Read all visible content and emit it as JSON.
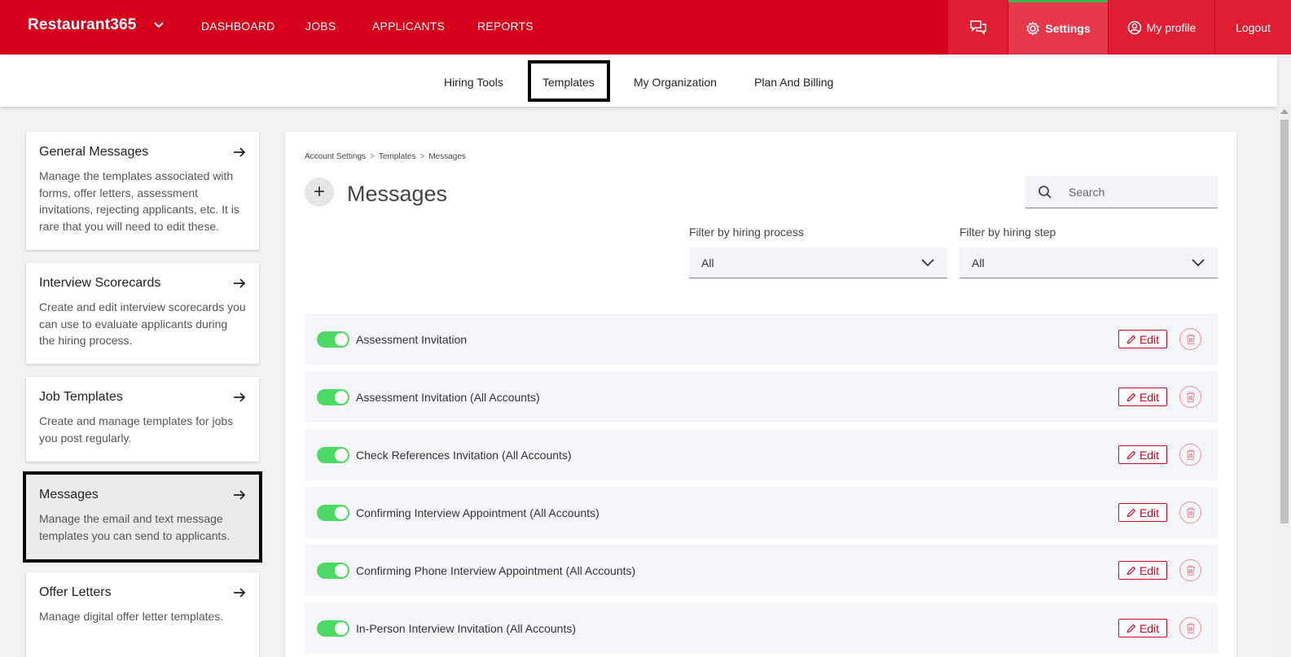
{
  "topbar": {
    "brand": "Restaurant365",
    "nav": [
      "DASHBOARD",
      "JOBS",
      "APPLICANTS",
      "REPORTS"
    ],
    "settings_label": "Settings",
    "profile_label": "My profile",
    "logout_label": "Logout"
  },
  "subnav": {
    "items": [
      "Hiring Tools",
      "Templates",
      "My Organization",
      "Plan And Billing"
    ]
  },
  "sidebar": {
    "cards": [
      {
        "title": "General Messages",
        "desc": "Manage the templates associated with forms, offer letters, assessment invitations, rejecting applicants, etc. It is rare that you will need to edit these."
      },
      {
        "title": "Interview Scorecards",
        "desc": "Create and edit interview scorecards you can use to evaluate applicants during the hiring process."
      },
      {
        "title": "Job Templates",
        "desc": "Create and manage templates for jobs you post regularly."
      },
      {
        "title": "Messages",
        "desc": "Manage the email and text message templates you can send to applicants."
      },
      {
        "title": "Offer Letters",
        "desc": "Manage digital offer letter templates."
      }
    ]
  },
  "main": {
    "breadcrumb": [
      "Account Settings",
      "Templates",
      "Messages"
    ],
    "breadcrumb_sep": ">",
    "add_label": "+",
    "title": "Messages",
    "search_placeholder": "Search",
    "filter_process_label": "Filter by hiring process",
    "filter_process_value": "All",
    "filter_step_label": "Filter by hiring step",
    "filter_step_value": "All",
    "edit_label": "Edit",
    "rows": [
      {
        "name": "Assessment Invitation",
        "enabled": true
      },
      {
        "name": "Assessment Invitation (All Accounts)",
        "enabled": true
      },
      {
        "name": "Check References Invitation (All Accounts)",
        "enabled": true
      },
      {
        "name": "Confirming Interview Appointment (All Accounts)",
        "enabled": true
      },
      {
        "name": "Confirming Phone Interview Appointment (All Accounts)",
        "enabled": true
      },
      {
        "name": "In-Person Interview Invitation (All Accounts)",
        "enabled": true
      }
    ]
  },
  "colors": {
    "brand_red": "#d6001c",
    "toggle_green": "#4cd964",
    "active_indicator": "#39b54a"
  },
  "icons": {
    "brand_menu": "chevron-down-icon",
    "chat": "chat-icon",
    "settings": "gear-icon",
    "profile": "user-circle-icon",
    "card_arrow": "arrow-right-icon",
    "search": "search-icon",
    "select": "chevron-down-icon",
    "edit": "pencil-icon",
    "delete": "trash-icon"
  }
}
